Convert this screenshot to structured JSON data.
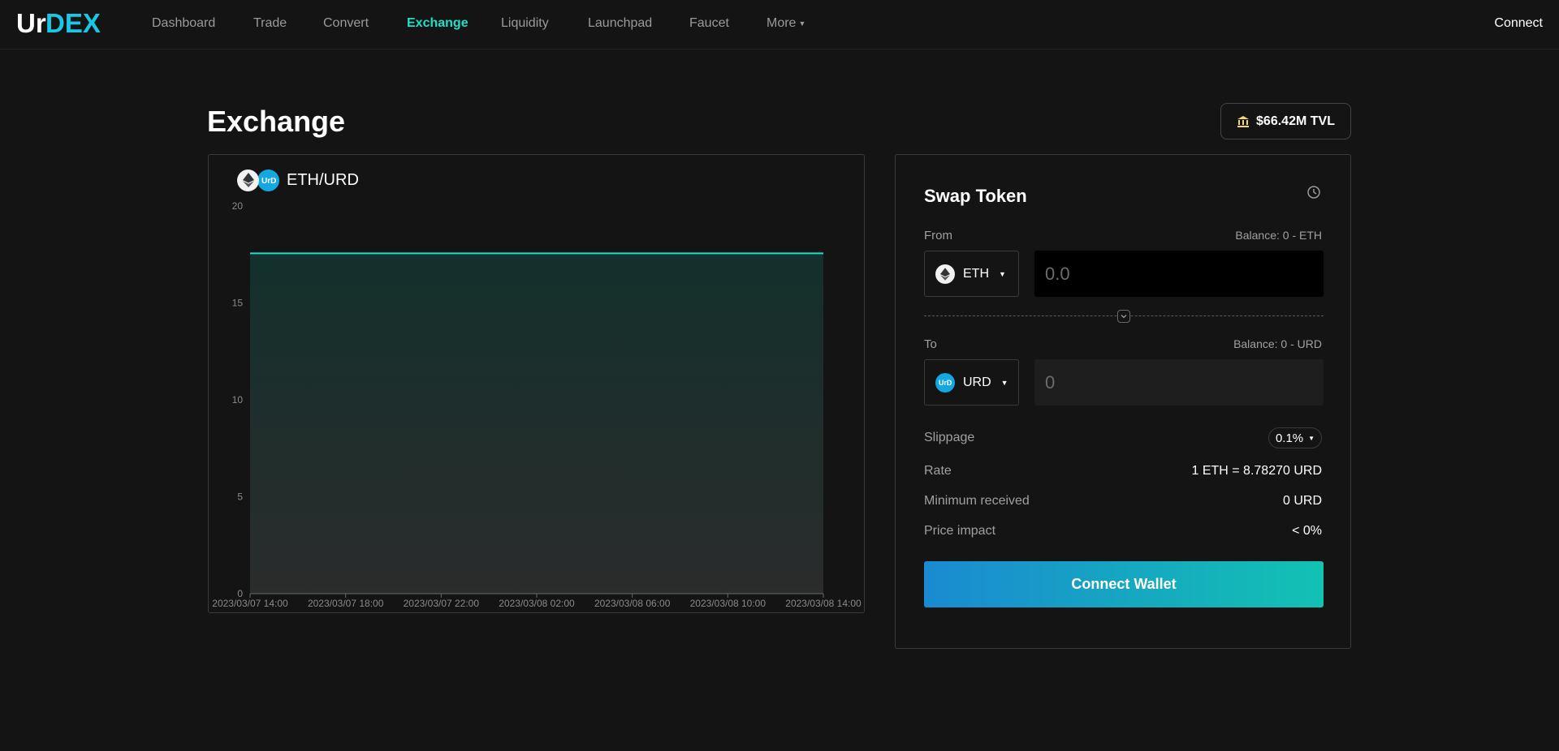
{
  "nav": {
    "logo_text": "UrDEX",
    "items": [
      {
        "label": "Dashboard",
        "active": false
      },
      {
        "label": "Trade",
        "active": false
      },
      {
        "label": "Convert",
        "active": false
      },
      {
        "label": "Exchange",
        "active": true
      },
      {
        "label": "Liquidity",
        "active": false
      },
      {
        "label": "Launchpad",
        "active": false
      },
      {
        "label": "Faucet",
        "active": false
      },
      {
        "label": "More",
        "active": false
      }
    ],
    "connect_label": "Connect"
  },
  "page": {
    "title": "Exchange",
    "tvl": "$66.42M TVL",
    "tvl_icon": "bank-icon"
  },
  "chart": {
    "pair": "ETH/URD",
    "base_token_icon": "eth-icon",
    "quote_token_icon": "urd-icon"
  },
  "chart_data": {
    "type": "area",
    "x": [
      "2023/03/07 14:00",
      "2023/03/07 18:00",
      "2023/03/07 22:00",
      "2023/03/08 02:00",
      "2023/03/08 06:00",
      "2023/03/08 10:00",
      "2023/03/08 14:00"
    ],
    "series": [
      {
        "values": [
          17.56,
          17.56,
          17.56,
          17.56,
          17.56,
          17.56,
          17.56
        ]
      }
    ],
    "y_ticks": [
      0,
      5,
      10,
      15,
      20
    ],
    "ylim": [
      0,
      20
    ],
    "grid": false,
    "line_color": "#1ee0c6"
  },
  "swap": {
    "title": "Swap Token",
    "from_label": "From",
    "from_balance": "Balance: 0 - ETH",
    "from_token": "ETH",
    "from_placeholder": "0.0",
    "to_label": "To",
    "to_balance": "Balance: 0 - URD",
    "to_token": "URD",
    "to_placeholder": "0",
    "slippage_label": "Slippage",
    "slippage_value": "0.1%",
    "rate_label": "Rate",
    "rate_value": "1 ETH = 8.78270 URD",
    "min_received_label": "Minimum received",
    "min_received_value": "0 URD",
    "price_impact_label": "Price impact",
    "price_impact_value": "< 0%",
    "connect_wallet_label": "Connect Wallet"
  },
  "colors": {
    "accent": "#1ee0c6",
    "background": "#141414",
    "button_gradient_start": "#1a8ad1",
    "button_gradient_end": "#12c2b2"
  }
}
